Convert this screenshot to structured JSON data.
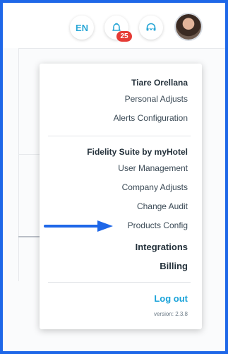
{
  "header": {
    "language_label": "EN",
    "notifications_count": "25",
    "bell_icon": "bell-icon",
    "support_icon": "headset-icon"
  },
  "user_menu": {
    "user_name": "Tiare Orellana",
    "personal_adjusts": "Personal Adjusts",
    "alerts_configuration": "Alerts Configuration",
    "suite_title": "Fidelity Suite by myHotel",
    "user_management": "User Management",
    "company_adjusts": "Company Adjusts",
    "change_audit": "Change Audit",
    "products_config": "Products Config",
    "integrations": "Integrations",
    "billing": "Billing",
    "logout": "Log out",
    "version": "version: 2.3.8"
  },
  "colors": {
    "frame_border": "#1e67e8",
    "accent": "#2aa7d6",
    "badge": "#e53b35",
    "arrow": "#1e67e8"
  }
}
